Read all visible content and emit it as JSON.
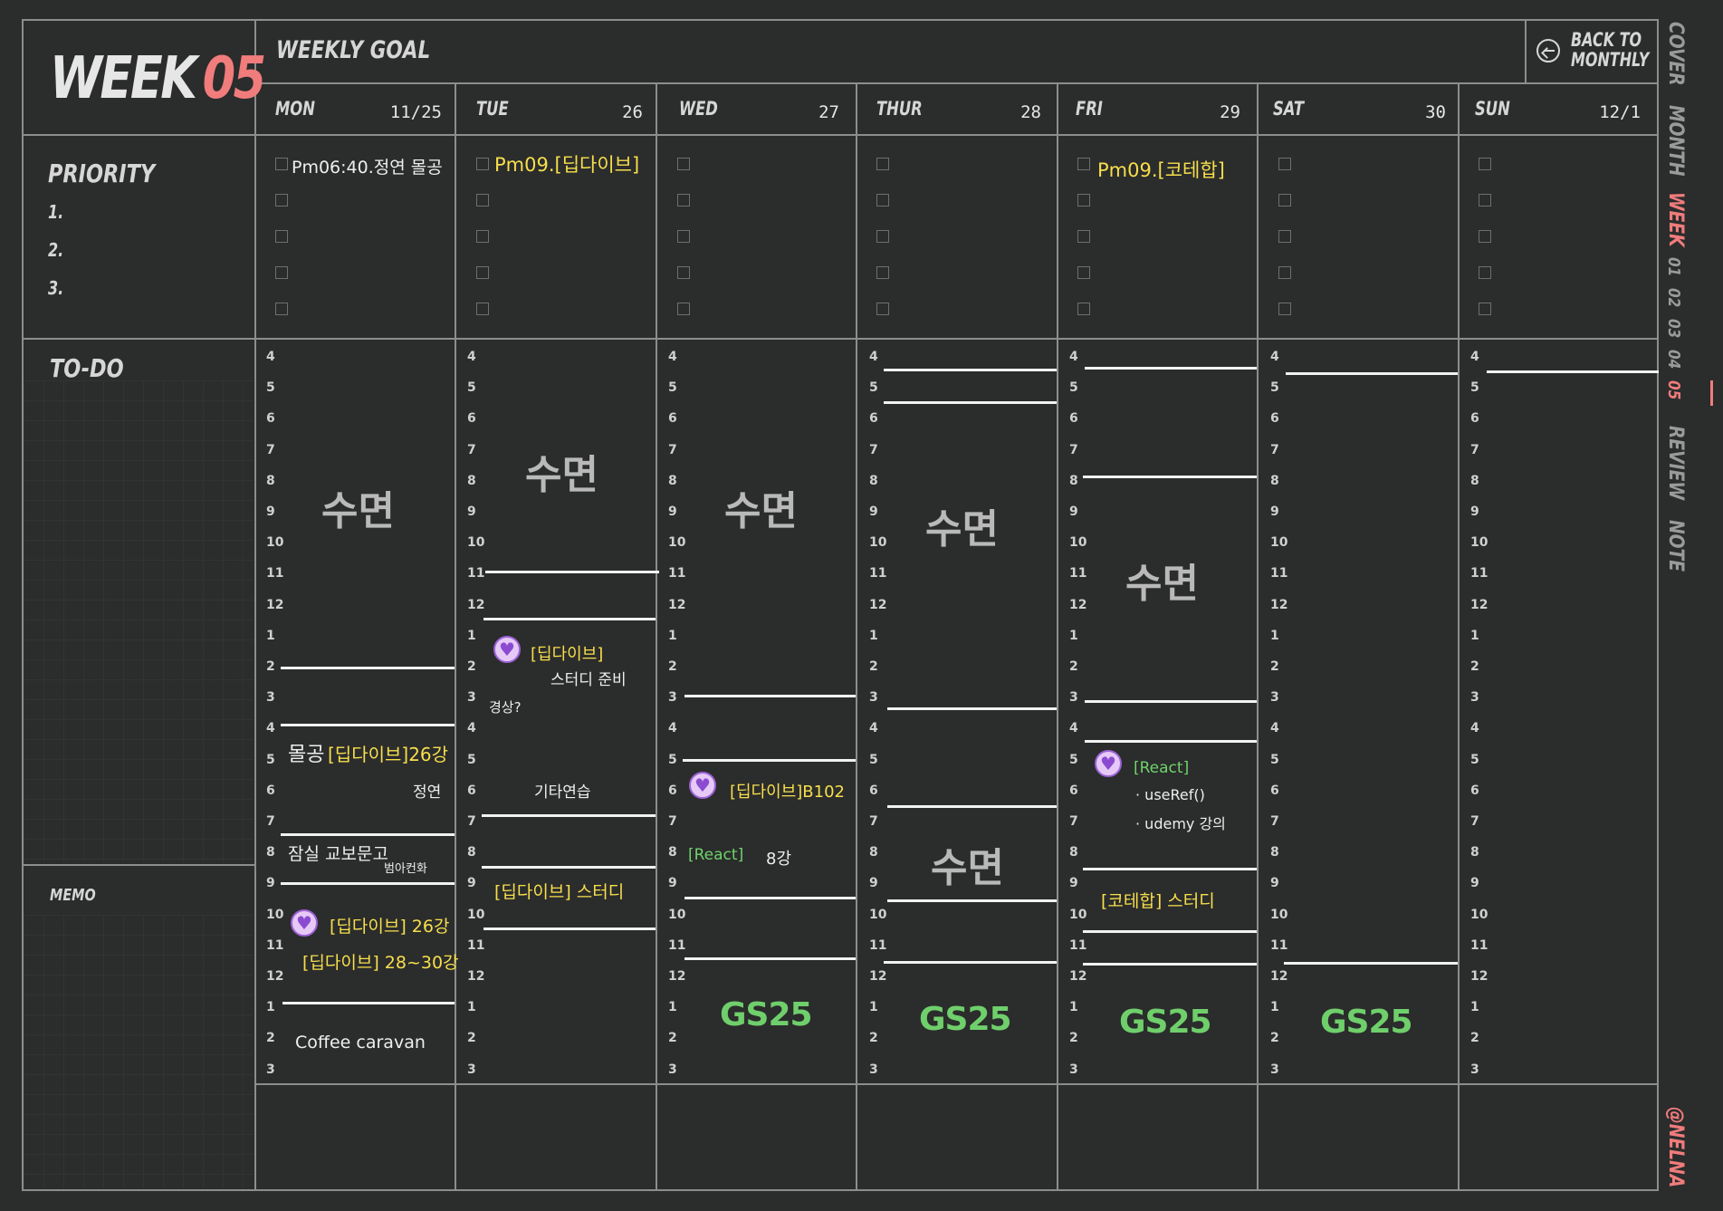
{
  "header": {
    "week_label": "WEEK",
    "week_number": "05",
    "weekly_goal_label": "WEEKLY GOAL",
    "back_label_line1": "BACK TO",
    "back_label_line2": "MONTHLY"
  },
  "days": [
    {
      "name": "MON",
      "date": "11/25"
    },
    {
      "name": "TUE",
      "date": "26"
    },
    {
      "name": "WED",
      "date": "27"
    },
    {
      "name": "THUR",
      "date": "28"
    },
    {
      "name": "FRI",
      "date": "29"
    },
    {
      "name": "SAT",
      "date": "30"
    },
    {
      "name": "SUN",
      "date": "12/1"
    }
  ],
  "priority": {
    "label": "PRIORITY",
    "items": [
      "1.",
      "2.",
      "3."
    ]
  },
  "todo_label": "TO-DO",
  "memo_label": "MEMO",
  "hours": [
    "4",
    "5",
    "6",
    "7",
    "8",
    "9",
    "10",
    "11",
    "12",
    "1",
    "2",
    "3",
    "4",
    "5",
    "6",
    "7",
    "8",
    "9",
    "10",
    "11",
    "12",
    "1",
    "2",
    "3"
  ],
  "priority_notes": {
    "mon": "Pm06:40.정연 몰공",
    "tue": "Pm09.[딥다이브]",
    "fri": "Pm09.[코테합]"
  },
  "schedule": {
    "sleep": "수면",
    "gs25": "GS25",
    "mon": {
      "a1": "몰공",
      "a2": "[딥다이브]26강",
      "a3": "정연",
      "b1": "잠실 교보문고",
      "b2": "범아컨화",
      "c1": "[딥다이브] 26강",
      "c2": "[딥다이브] 28~30강",
      "d1": "Coffee caravan"
    },
    "tue": {
      "a1": "[딥다이브]",
      "a2": "스터디 준비",
      "a3": "경상?",
      "b1": "기타연습",
      "c1": "[딥다이브] 스터디"
    },
    "wed": {
      "a1": "[딥다이브]B102",
      "b1": "[React]",
      "b2": "8강"
    },
    "fri": {
      "a1": "[React]",
      "a2": "· useRef()",
      "a3": "· udemy 강의",
      "b1": "[코테합] 스터디"
    }
  },
  "side_tabs": [
    "COVER",
    "MONTH",
    "WEEK",
    "01",
    "02",
    "03",
    "04",
    "05",
    "REVIEW",
    "NOTE"
  ],
  "credit": "@NELNA"
}
